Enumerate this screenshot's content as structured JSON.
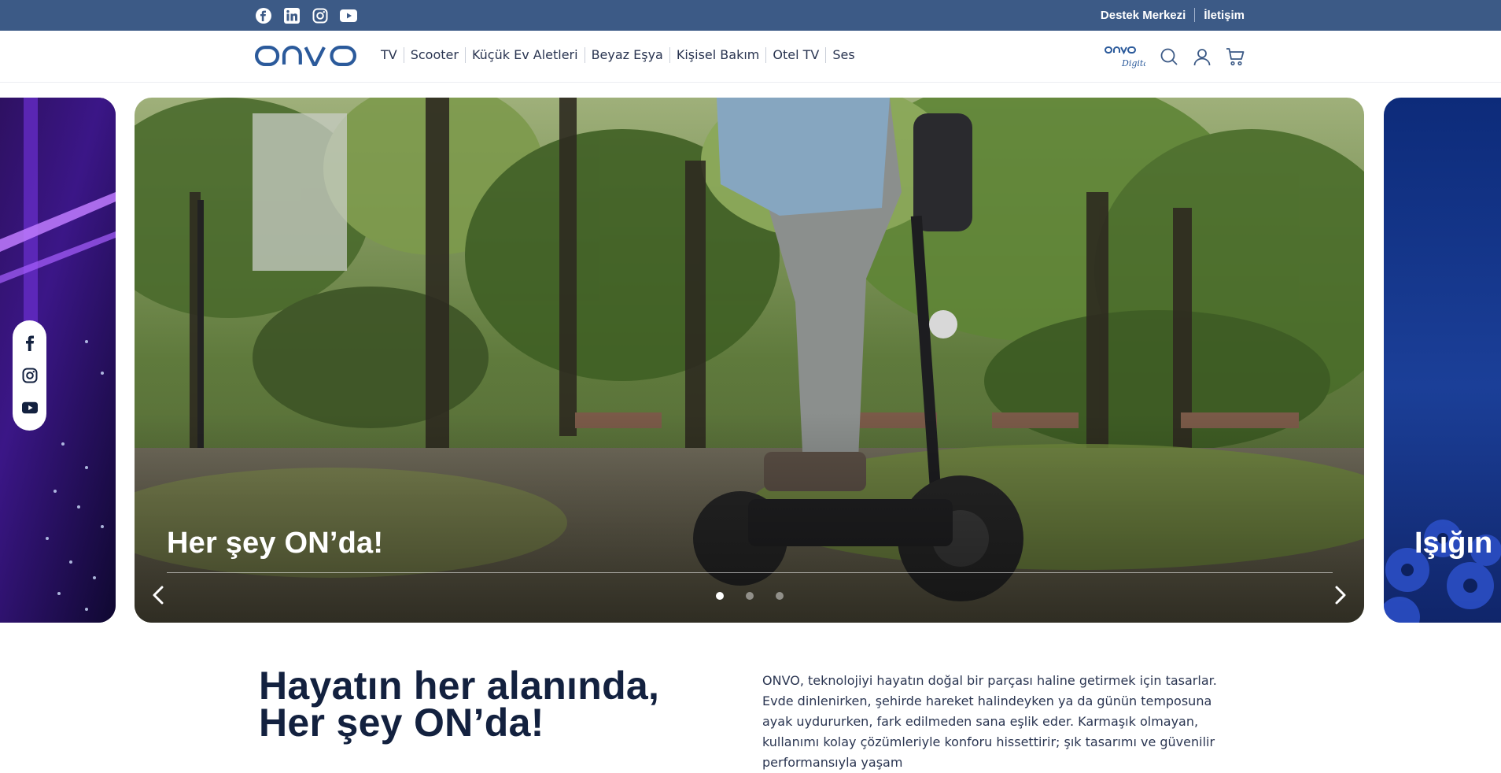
{
  "topbar": {
    "social_icons": [
      "facebook-icon",
      "linkedin-icon",
      "instagram-icon",
      "youtube-icon"
    ],
    "support_label": "Destek Merkezi",
    "contact_label": "İletişim",
    "bg_color": "#3c5a86"
  },
  "header": {
    "logo_text": "onvo",
    "nav": [
      {
        "label": "TV"
      },
      {
        "label": "Scooter"
      },
      {
        "label": "Küçük Ev Aletleri"
      },
      {
        "label": "Beyaz Eşya"
      },
      {
        "label": "Kişisel Bakım"
      },
      {
        "label": "Otel TV"
      },
      {
        "label": "Ses"
      }
    ],
    "digital_logo_text": "onvo",
    "digital_logo_sub": "Digital",
    "icons": [
      "search-icon",
      "user-icon",
      "cart-icon"
    ]
  },
  "slider": {
    "caption": "Her şey ON’da!",
    "next_caption": "Işığın v",
    "dots": 3,
    "active_dot": 1
  },
  "float_social": {
    "icons": [
      "facebook-icon",
      "instagram-icon",
      "youtube-icon"
    ]
  },
  "intro": {
    "headline_line1": "Hayatın her alanında,",
    "headline_line2": "Her şey ON’da!",
    "para_line1": "ONVO, teknolojiyi hayatın doğal bir parçası haline getirmek için tasarlar.",
    "para_line2": "Evde dinlenirken, şehirde hareket halindeyken ya da günün temposuna ayak uydururken, fark edilmeden sana eşlik eder. Karmaşık olmayan, kullanımı kolay çözümleriyle konforu hissettirir; şık tasarımı ve güvenilir performansıyla yaşam"
  },
  "colors": {
    "brand_blue": "#2b5a9b",
    "headline": "#13213f",
    "text": "#2a3551"
  }
}
